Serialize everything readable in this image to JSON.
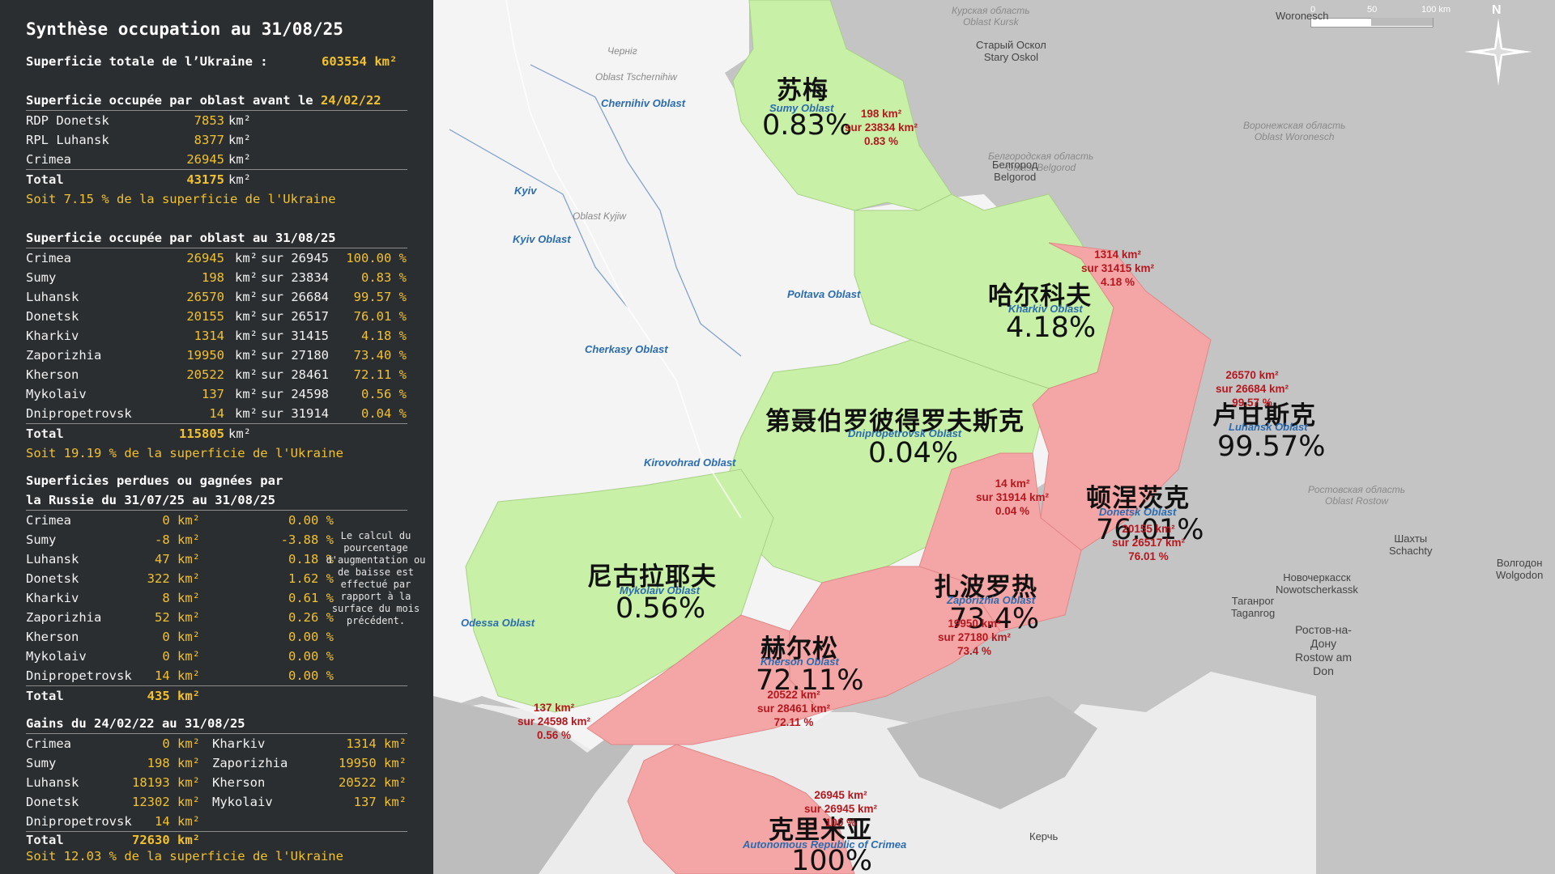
{
  "panel": {
    "title": "Synthèse occupation au 31/08/25",
    "total_area_label": "Superficie totale de l’Ukraine :",
    "total_area_value": "603554 km²",
    "before": {
      "header_prefix": "Superficie occupée par oblast avant le",
      "header_date": "24/02/22",
      "rows": [
        {
          "name": "RDP Donetsk",
          "value": "7853",
          "unit": "km²"
        },
        {
          "name": "RPL Luhansk",
          "value": "8377",
          "unit": "km²"
        },
        {
          "name": "Crimea",
          "value": "26945",
          "unit": "km²"
        }
      ],
      "total_label": "Total",
      "total_value": "43175",
      "total_unit": "km²",
      "summary": "Soit 7.15 % de la superficie de l'Ukraine"
    },
    "current": {
      "header": "Superficie occupée par oblast au 31/08/25",
      "rows": [
        {
          "name": "Crimea",
          "value": "26945",
          "unit": "km²",
          "sur": "sur 26945",
          "pct": "100.00 %"
        },
        {
          "name": "Sumy",
          "value": "198",
          "unit": "km²",
          "sur": "sur 23834",
          "pct": "0.83 %"
        },
        {
          "name": "Luhansk",
          "value": "26570",
          "unit": "km²",
          "sur": "sur 26684",
          "pct": "99.57 %"
        },
        {
          "name": "Donetsk",
          "value": "20155",
          "unit": "km²",
          "sur": "sur 26517",
          "pct": "76.01 %"
        },
        {
          "name": "Kharkiv",
          "value": "1314",
          "unit": "km²",
          "sur": "sur 31415",
          "pct": "4.18 %"
        },
        {
          "name": "Zaporizhia",
          "value": "19950",
          "unit": "km²",
          "sur": "sur 27180",
          "pct": "73.40 %"
        },
        {
          "name": "Kherson",
          "value": "20522",
          "unit": "km²",
          "sur": "sur 28461",
          "pct": "72.11 %"
        },
        {
          "name": "Mykolaiv",
          "value": "137",
          "unit": "km²",
          "sur": "sur 24598",
          "pct": "0.56 %"
        },
        {
          "name": "Dnipropetrovsk",
          "value": "14",
          "unit": "km²",
          "sur": "sur 31914",
          "pct": "0.04 %"
        }
      ],
      "total_label": "Total",
      "total_value": "115805",
      "total_unit": "km²",
      "summary": "Soit 19.19 % de la superficie de l'Ukraine"
    },
    "changes": {
      "header_line1": "Superficies perdues ou gagnées par",
      "header_line2": "la Russie du 31/07/25 au 31/08/25",
      "rows": [
        {
          "name": "Crimea",
          "value": "0 km²",
          "pct": "0.00 %"
        },
        {
          "name": "Sumy",
          "value": "-8 km²",
          "pct": "-3.88 %"
        },
        {
          "name": "Luhansk",
          "value": "47 km²",
          "pct": "0.18 %"
        },
        {
          "name": "Donetsk",
          "value": "322 km²",
          "pct": "1.62 %"
        },
        {
          "name": "Kharkiv",
          "value": "8 km²",
          "pct": "0.61 %"
        },
        {
          "name": "Zaporizhia",
          "value": "52 km²",
          "pct": "0.26 %"
        },
        {
          "name": "Kherson",
          "value": "0 km²",
          "pct": "0.00 %"
        },
        {
          "name": "Mykolaiv",
          "value": "0 km²",
          "pct": "0.00 %"
        },
        {
          "name": "Dnipropetrovsk",
          "value": "14 km²",
          "pct": "0.00 %"
        }
      ],
      "total_label": "Total",
      "total_value": "435 km²",
      "note": "Le calcul du pourcentage d'augmentation ou de baisse est effectué par rapport à la surface du mois précédent."
    },
    "gains": {
      "header": "Gains du 24/02/22 au 31/08/25",
      "rows": [
        {
          "name": "Crimea",
          "value": "0 km²",
          "name2": "Kharkiv",
          "value2": "1314 km²"
        },
        {
          "name": "Sumy",
          "value": "198 km²",
          "name2": "Zaporizhia",
          "value2": "19950 km²"
        },
        {
          "name": "Luhansk",
          "value": "18193 km²",
          "name2": "Kherson",
          "value2": "20522 km²"
        },
        {
          "name": "Donetsk",
          "value": "12302 km²",
          "name2": "Mykolaiv",
          "value2": "137 km²"
        },
        {
          "name": "Dnipropetrovsk",
          "value": "14 km²",
          "name2": "",
          "value2": ""
        }
      ],
      "total_label": "Total",
      "total_value": "72630 km²",
      "summary": "Soit 12.03 % de la superficie de l'Ukraine"
    }
  },
  "map": {
    "colors": {
      "occupied_pct_zone": "#f4a5a5",
      "low_occupation_zone": "#c8f0a6",
      "ukraine_other": "#f4f4f4",
      "russia": "#c3c3c3",
      "sea": "#bdbdbd",
      "text_red": "#b3181f",
      "oblast_blue": "#2b6cb0"
    },
    "regions": [
      {
        "cn": "苏梅",
        "oblast": "Sumy Oblast",
        "pct": "0.83%",
        "red": [
          "198 km²",
          "sur 23834 km²",
          "0.83 %"
        ]
      },
      {
        "cn": "哈尔科夫",
        "oblast": "Kharkiv Oblast",
        "pct": "4.18%",
        "red": [
          "1314 km²",
          "sur 31415 km²",
          "4.18 %"
        ]
      },
      {
        "cn": "卢甘斯克",
        "oblast": "Luhansk Oblast",
        "pct": "99.57%",
        "red": [
          "26570 km²",
          "sur 26684 km²",
          "99.57 %"
        ]
      },
      {
        "cn": "第聂伯罗彼得罗夫斯克",
        "oblast": "Dnipropetrovsk Oblast",
        "pct": "0.04%",
        "red": [
          "14 km²",
          "sur 31914 km²",
          "0.04 %"
        ]
      },
      {
        "cn": "顿涅茨克",
        "oblast": "Donetsk Oblast",
        "pct": "76.01%",
        "red": [
          "20155 km²",
          "sur 26517 km²",
          "76.01 %"
        ]
      },
      {
        "cn": "尼古拉耶夫",
        "oblast": "Mykolaiv Oblast",
        "pct": "0.56%",
        "red": [
          "137 km²",
          "sur 24598 km²",
          "0.56 %"
        ]
      },
      {
        "cn": "扎波罗热",
        "oblast": "Zaporizhia Oblast",
        "pct": "73.4%",
        "red": [
          "19950 km²",
          "sur 27180 km²",
          "73.4 %"
        ]
      },
      {
        "cn": "赫尔松",
        "oblast": "Kherson Oblast",
        "pct": "72.11%",
        "red": [
          "20522 km²",
          "sur 28461 km²",
          "72.11 %"
        ]
      },
      {
        "cn": "克里米亚",
        "oblast": "Autonomous Republic of Crimea",
        "pct": "100%",
        "red": [
          "26945 km²",
          "sur 26945 km²",
          "100 %"
        ]
      }
    ],
    "other_oblasts": [
      "Chernihiv Oblast",
      "Kyiv Oblast",
      "Poltava Oblast",
      "Cherkasy Oblast",
      "Kirovohrad Oblast",
      "Odessa Oblast"
    ],
    "cities": [
      "Белгород",
      "Belgorod",
      "Старый Оскол",
      "Stary Oskol",
      "Таганрог",
      "Taganrog",
      "Ростов-на-",
      "Дону",
      "Rostow am",
      "Don",
      "Шахты",
      "Schachty",
      "Новочеркасск",
      "Nowotscherkassk",
      "Волгодон",
      "Wolgodon",
      "Kyiv",
      "Керчь"
    ],
    "grey_labels": [
      "Курская область",
      "Oblast Kursk",
      "Воронежская область",
      "Oblast Woronesch",
      "Белгородская область",
      "Oblast Belgorod",
      "Ростовская область",
      "Oblast Rostow",
      "Woronesch",
      "Черніг",
      "Oblast Tschernihiw",
      "Oblast Kyjiw"
    ],
    "scale": [
      "0",
      "50",
      "100 km"
    ],
    "north": "N"
  }
}
